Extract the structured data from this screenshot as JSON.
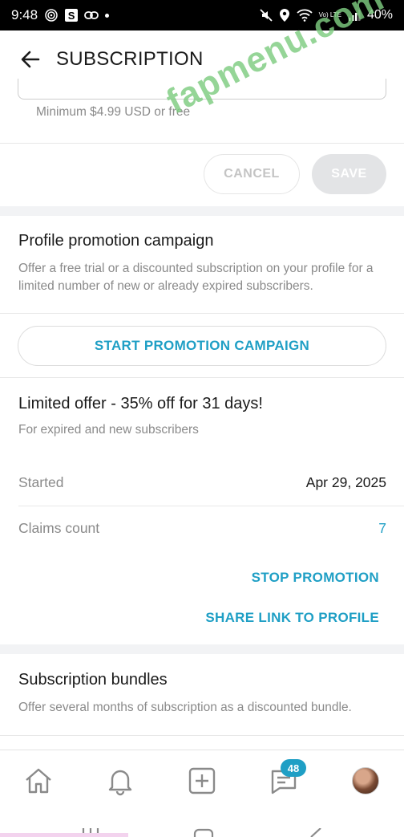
{
  "status_bar": {
    "time": "9:48",
    "app_badge": "S",
    "battery": "40%",
    "network": "Vo) LTE"
  },
  "header": {
    "title": "SUBSCRIPTION"
  },
  "price_section": {
    "hint": "Minimum $4.99 USD or free",
    "cancel_label": "CANCEL",
    "save_label": "SAVE"
  },
  "promotion": {
    "title": "Profile promotion campaign",
    "description": "Offer a free trial or a discounted subscription on your profile for a limited number of new or already expired subscribers.",
    "start_label": "START PROMOTION CAMPAIGN"
  },
  "offer": {
    "title": "Limited offer - 35% off for 31 days!",
    "subtitle": "For expired and new subscribers",
    "started_label": "Started",
    "started_value": "Apr 29, 2025",
    "claims_label": "Claims count",
    "claims_value": "7",
    "stop_label": "STOP PROMOTION",
    "share_label": "SHARE LINK TO PROFILE"
  },
  "bundles": {
    "title": "Subscription bundles",
    "description": "Offer several months of subscription as a discounted bundle."
  },
  "bottom_nav": {
    "messages_badge": "48",
    "items": [
      "home-icon",
      "bell-icon",
      "add-post-icon",
      "messages-icon",
      "avatar"
    ]
  },
  "watermark": "fapmenu.com",
  "colors": {
    "accent": "#1f9fc5",
    "muted_text": "#8a8a8a",
    "watermark": "#7ecc80"
  }
}
